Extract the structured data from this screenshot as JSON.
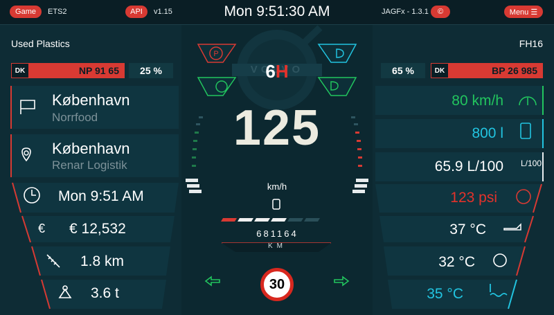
{
  "topbar": {
    "game_label": "Game",
    "game_name": "ETS2",
    "api_label": "API",
    "api_version": "v1.15",
    "clock": "Mon 9:51:30 AM",
    "skin_name": "JAGFx - 1.3.1",
    "copyright_symbol": "©",
    "menu_label": "Menu ☰"
  },
  "left": {
    "cargo": "Used Plastics",
    "trailer_plate_country": "DK",
    "trailer_plate": "NP 91 65",
    "trailer_damage": "25 %",
    "source_city": "København",
    "source_company": "Norrfood",
    "dest_city": "København",
    "dest_company": "Renar Logistik",
    "eta": "Mon 9:51 AM",
    "income": "€ 12,532",
    "distance": "1.8 km",
    "weight": "3.6 t"
  },
  "right": {
    "truck_model": "FH16",
    "truck_damage": "65 %",
    "truck_plate_country": "DK",
    "truck_plate": "BP 26 985",
    "cruise_speed": "80 km/h",
    "fuel": "800 l",
    "consumption": "65.9 L/100",
    "air_pressure": "123 psi",
    "oil_temp": "37 °C",
    "brake_temp": "32 °C",
    "water_temp": "35 °C"
  },
  "center": {
    "gear_mode": "6",
    "gear_suffix": "H",
    "brand": "VOLVO",
    "speed": "125",
    "speed_unit": "km/h",
    "odometer": "681164",
    "odometer_unit": "KM",
    "speed_limit": "30"
  },
  "colors": {
    "accent_red": "#d83a33",
    "green": "#22c55e",
    "cyan": "#22c4e0",
    "background": "#0e2c35"
  },
  "icons": {
    "parking_brake": "parking-brake-icon",
    "retarder": "retarder-icon",
    "low_beam": "low-beam-icon",
    "high_beam": "high-beam-icon",
    "fuel_pump": "fuel-pump-icon",
    "blinker_left": "blinker-left-icon",
    "blinker_right": "blinker-right-icon"
  }
}
